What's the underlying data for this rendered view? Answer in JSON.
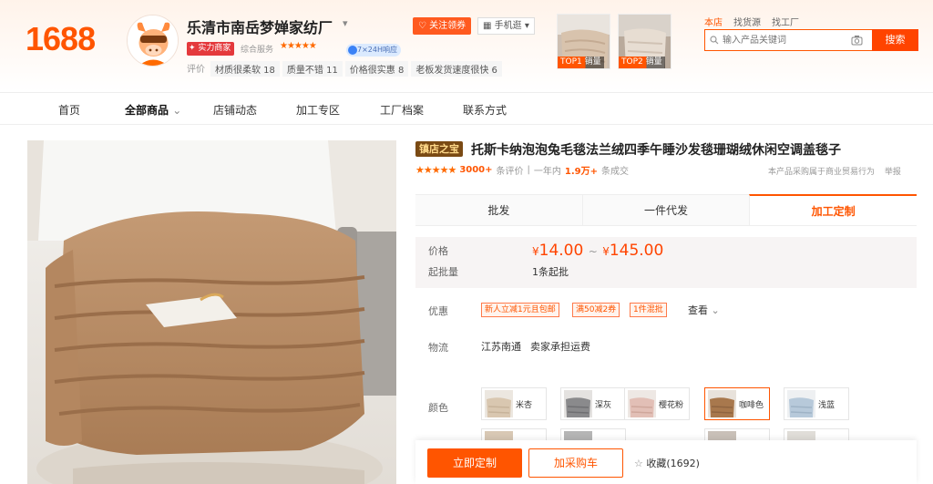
{
  "header": {
    "logo": "1688",
    "shop_name": "乐清市南岳梦婵家纺厂",
    "strength_tag": "实力商家",
    "service_label": "综合服务",
    "rating_stars": "★★★★★",
    "response_badge": "7×24H响应",
    "metrics_label": "评价",
    "metrics": [
      "材质很柔软 18",
      "质量不错 11",
      "价格很实惠 8",
      "老板发货速度很快 6"
    ],
    "follow_label": "关注领券",
    "mobile_label": "手机逛",
    "top_cards": [
      {
        "label": "TOP1 销量"
      },
      {
        "label": "TOP2 销量"
      }
    ],
    "search_tabs": [
      "本店",
      "找货源",
      "找工厂"
    ],
    "search_placeholder": "输入产品关键词",
    "search_button": "搜索"
  },
  "nav": {
    "items": [
      "首页",
      "全部商品",
      "店铺动态",
      "加工专区",
      "工厂档案",
      "联系方式"
    ]
  },
  "product": {
    "promo_tag": "镇店之宝",
    "title": "托斯卡纳泡泡兔毛毯法兰绒四季午睡沙发毯珊瑚绒休闲空调盖毯子",
    "rating_stars": "★★★★★",
    "reviews_count": "3000+",
    "reviews_label": "条评价",
    "sales_period": "一年内",
    "sales_count": "1.9万+",
    "sales_label": "条成交",
    "trade_note": "本产品采购属于商业贸易行为",
    "report_label": "举报",
    "tabs": [
      "批发",
      "一件代发",
      "加工定制"
    ],
    "active_tab": "加工定制",
    "price_label": "价格",
    "currency": "¥",
    "price_min": "14.00",
    "price_sep": "~",
    "price_max": "145.00",
    "moq_label": "起批量",
    "moq_value": "1条起批",
    "discount_label": "优惠",
    "coupons": [
      "新人立减1元且包邮",
      "满50减2券",
      "1件混批"
    ],
    "more_label": "查看",
    "logistics_label": "物流",
    "logistics_from": "江苏南通",
    "logistics_fee": "卖家承担运费",
    "color_label": "颜色",
    "colors": [
      {
        "name": "米杏",
        "hex": "#d9c7b0"
      },
      {
        "name": "深灰",
        "hex": "#8a8a8c"
      },
      {
        "name": "樱花粉",
        "hex": "#e2bfb6"
      },
      {
        "name": "咖啡色",
        "hex": "#a8784d"
      },
      {
        "name": "浅蓝",
        "hex": "#b7c9da"
      }
    ],
    "colors_row2": [
      {
        "hex": "#d8c8b4"
      },
      {
        "hex": "#b5b5b5"
      },
      {
        "hex": "#c9c0b8"
      },
      {
        "hex": "#e0ddd8"
      }
    ],
    "selected_color": "咖啡色",
    "buy_custom": "立即定制",
    "add_cart": "加采购车",
    "favorite_label": "收藏(1692)"
  },
  "colors": {
    "accent": "#ff5500",
    "price": "#ff4400"
  }
}
